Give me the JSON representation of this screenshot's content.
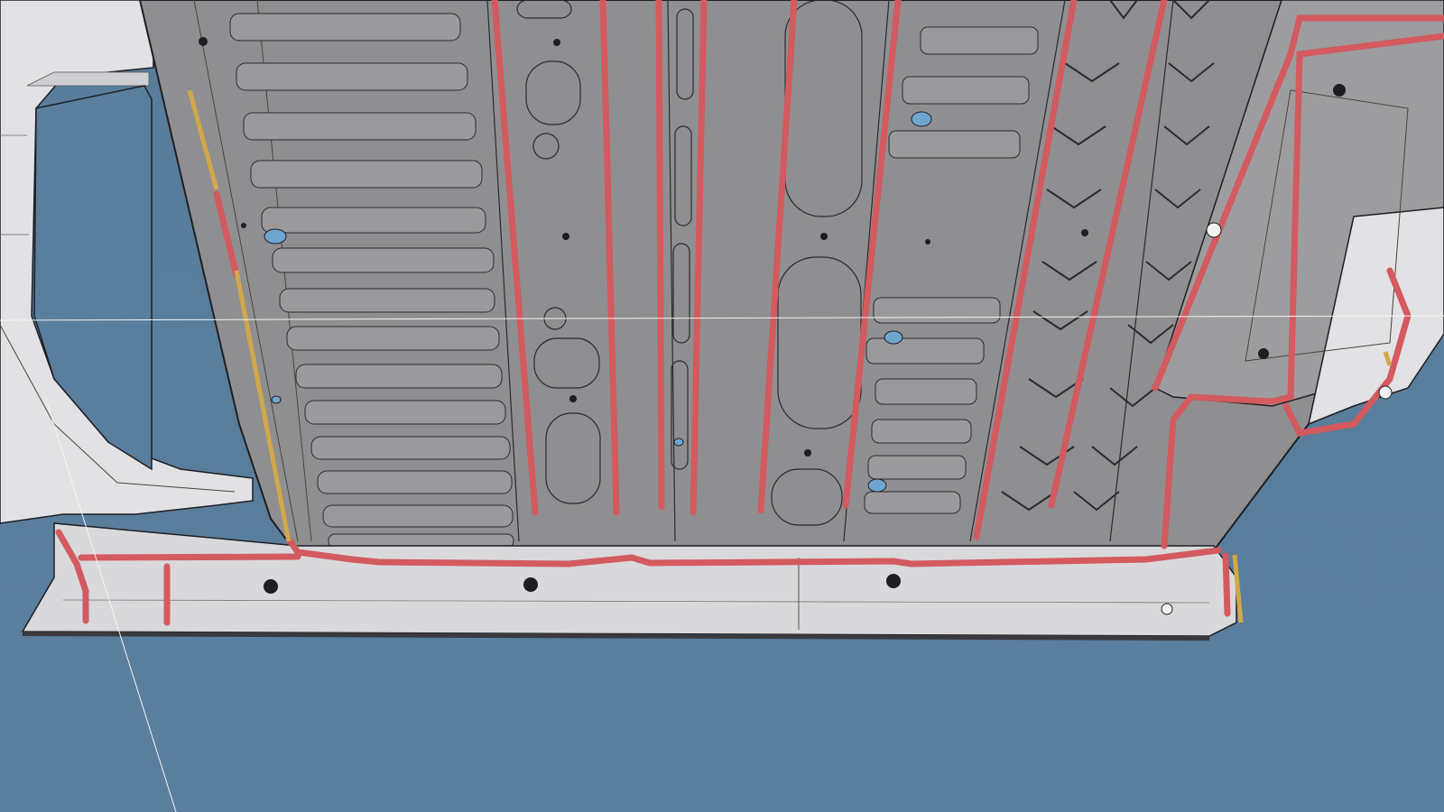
{
  "viewport": {
    "background_color": "#5a7f9e",
    "panel_color": "#8f8f91",
    "sill_color": "#d9d9dc",
    "seal_color": "#d35a5f",
    "adhesive_color": "#d2a84b",
    "hole_color": "#6fa6cf",
    "edge_color": "#1e1e22"
  }
}
